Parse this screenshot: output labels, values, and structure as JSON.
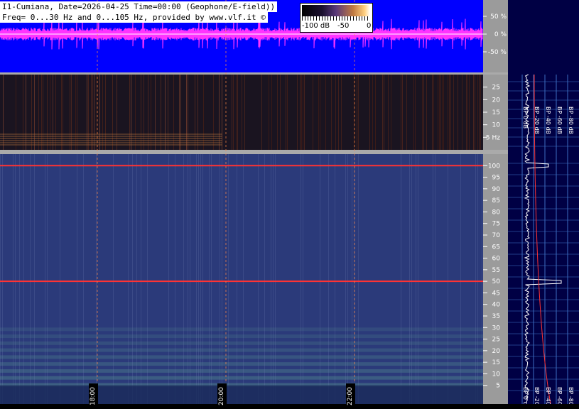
{
  "header": {
    "line1": "I1-Cumiana, Date=2026-04-25 Time=00:00 (Geophone/E-field))",
    "line2": "Freq= 0...30 Hz and 0...105 Hz, provided by www.vlf.it ©"
  },
  "colorbar": {
    "labels": [
      "-100 dB",
      "-50",
      "0"
    ]
  },
  "colors": {
    "waveform_bg": "#0000ff",
    "waveform_signal": "#ff33ff",
    "spectrogram_low_bg": "#1a1420",
    "spectrogram_high_bg": "#2b3a7a",
    "side_panel_bg": "#000044",
    "axis_panel_bg": "#9b9b9b",
    "mains_line": "#ff3333",
    "time_marker": "#ff8844"
  },
  "chart_data": [
    {
      "type": "line",
      "panel": "waveform",
      "ylabel_ticks": [
        "50 %",
        "0 %",
        "-50 %"
      ],
      "ylim": [
        -100,
        100
      ]
    },
    {
      "type": "heatmap",
      "panel": "spectrogram-low",
      "ylim": [
        0,
        30
      ],
      "ytick_labels": [
        "25",
        "20",
        "15",
        "10",
        "5 Hz"
      ],
      "yticks": [
        25,
        20,
        15,
        10,
        5
      ]
    },
    {
      "type": "heatmap",
      "panel": "spectrogram-high",
      "ylim": [
        0,
        105
      ],
      "ytick_labels": [
        "100",
        "95",
        "90",
        "85",
        "80",
        "75",
        "70",
        "65",
        "60",
        "55",
        "50",
        "45",
        "40",
        "35",
        "30",
        "25",
        "20",
        "15",
        "10",
        "5"
      ],
      "yticks": [
        100,
        95,
        90,
        85,
        80,
        75,
        70,
        65,
        60,
        55,
        50,
        45,
        40,
        35,
        30,
        25,
        20,
        15,
        10,
        5
      ],
      "time_labels": [
        "18:00",
        "20:00",
        "22:00"
      ],
      "lines": [
        100,
        50
      ]
    },
    {
      "type": "line",
      "panel": "side-spectrum",
      "bp_labels": [
        "BP 0 dB",
        "BP -20 dB",
        "BP -40 dB",
        "BP -60 dB",
        "BP -80 dB"
      ]
    }
  ]
}
